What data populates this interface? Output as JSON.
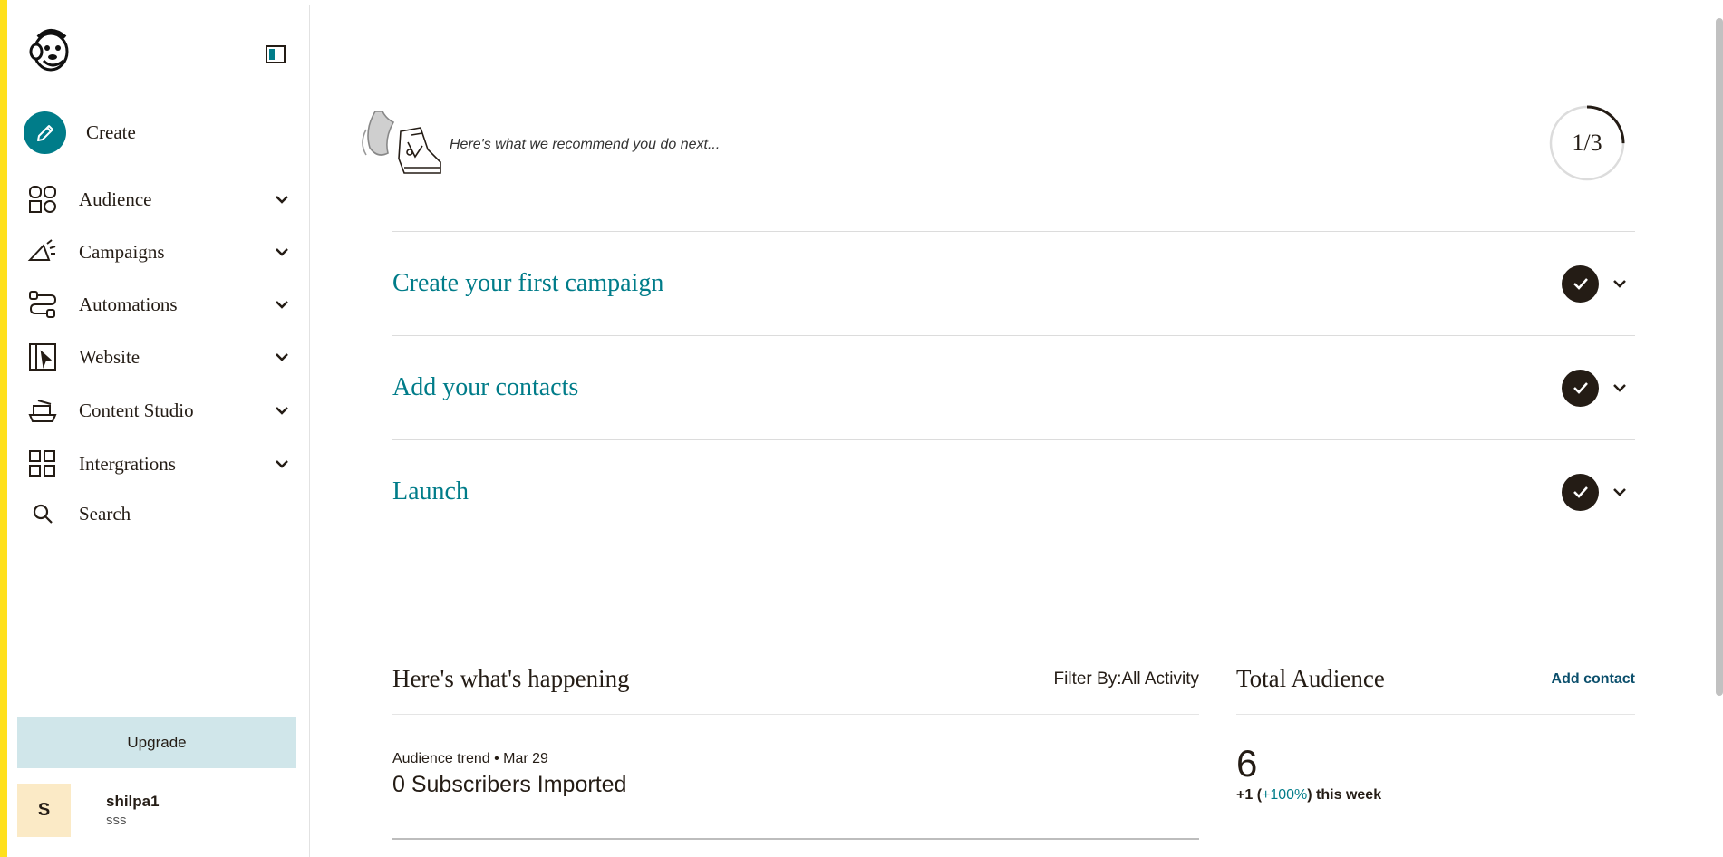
{
  "sidebar": {
    "create_label": "Create",
    "items": [
      {
        "label": "Audience"
      },
      {
        "label": "Campaigns"
      },
      {
        "label": "Automations"
      },
      {
        "label": "Website"
      },
      {
        "label": "Content Studio"
      },
      {
        "label": "Intergrations"
      },
      {
        "label": "Search"
      }
    ],
    "upgrade_label": "Upgrade",
    "account": {
      "initial": "S",
      "name": "shilpa1",
      "sub": "sss"
    }
  },
  "recommend": {
    "text": "Here's what we recommend you do next...",
    "progress_label": "1/3",
    "progress_fraction": 0.25
  },
  "steps": [
    {
      "title": "Create your first campaign",
      "done": true
    },
    {
      "title": "Add your contacts",
      "done": true
    },
    {
      "title": "Launch",
      "done": true
    }
  ],
  "happening": {
    "title": "Here's what's happening",
    "filter": "Filter By:All Activity",
    "trend_meta": "Audience trend • Mar 29",
    "trend_value": "0 Subscribers Imported"
  },
  "total": {
    "title": "Total Audience",
    "add_contact": "Add contact",
    "count": "6",
    "change_prefix": "+1 (",
    "change_pct": "+100%",
    "change_suffix": ") this week"
  },
  "colors": {
    "accent": "#007c89",
    "sidebar_stripe": "#ffe01b",
    "upgrade_bg": "#d0e6ea"
  }
}
